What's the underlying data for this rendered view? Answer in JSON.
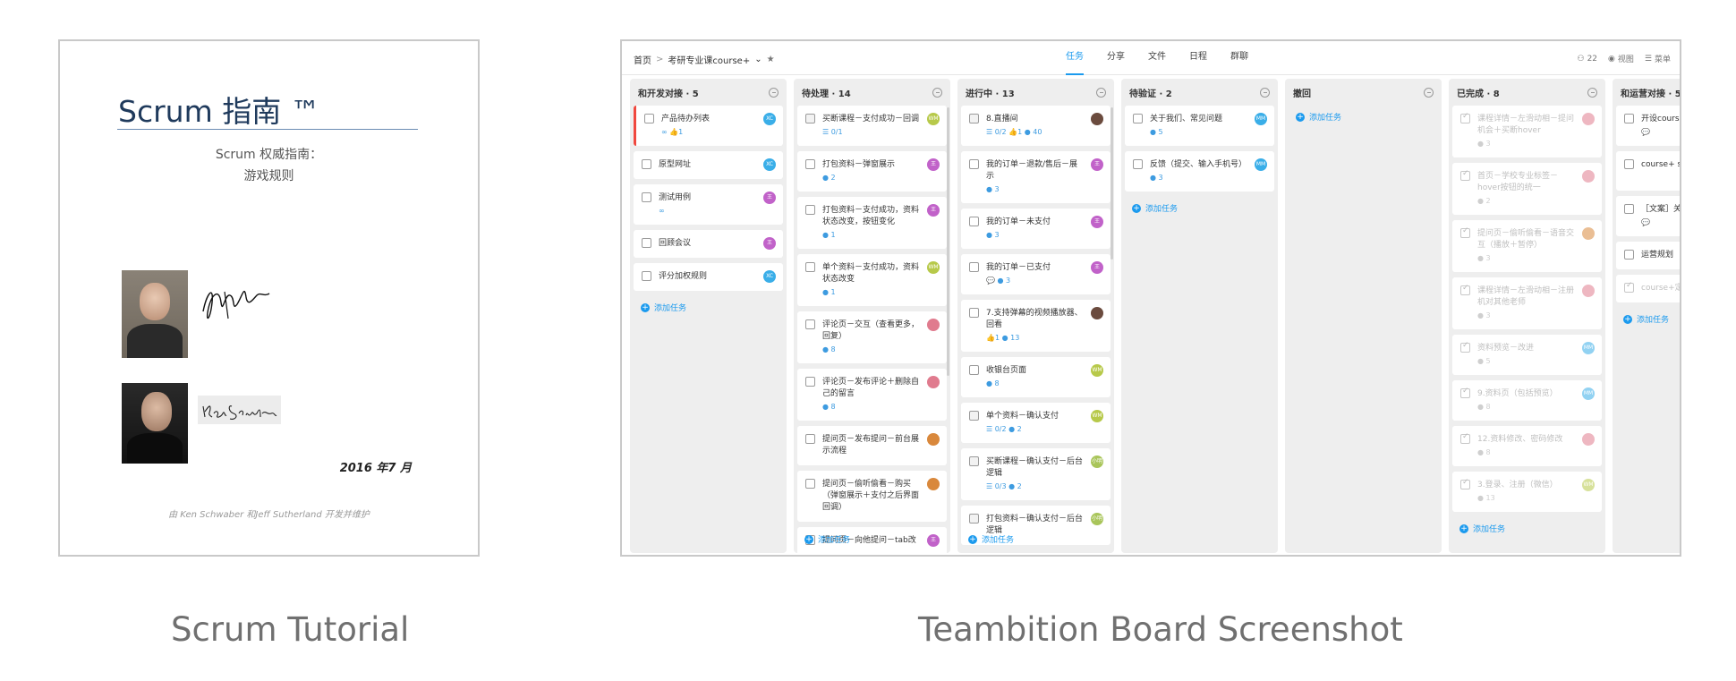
{
  "doc": {
    "title": "Scrum 指南 ™",
    "subtitle1": "Scrum 权威指南：",
    "subtitle2": "游戏规则",
    "date": "2016 年7 月",
    "footer": "由 Ken Schwaber 和Jeff Sutherland 开发并维护",
    "signature1": "Jeff Sutherland",
    "signature2": "Ken Schwaber"
  },
  "captions": {
    "left": "Scrum Tutorial",
    "right": "Teambition Board Screenshot"
  },
  "board": {
    "breadcrumb": {
      "home": "首页",
      "sep": ">",
      "project": "考研专业课course+"
    },
    "tabs": [
      "任务",
      "分享",
      "文件",
      "日程",
      "群聊"
    ],
    "tools": {
      "members": "22",
      "view": "视图",
      "menu": "菜单"
    },
    "add_task": "添加任务",
    "colors": {
      "accent": "#1b9aee",
      "highlight": "#f0483e"
    },
    "columns": [
      {
        "title": "和开发对接 · 5",
        "cards": [
          {
            "title": "产品待办列表",
            "meta": "∞  👍1",
            "avatar": "XC",
            "avcolor": "#3aaee8",
            "hl": true
          },
          {
            "title": "原型网址",
            "meta": "",
            "avatar": "XC",
            "avcolor": "#3aaee8"
          },
          {
            "title": "测试用例",
            "meta": "∞",
            "avatar": "王",
            "avcolor": "#c162c9"
          },
          {
            "title": "回顾会议",
            "meta": "",
            "avatar": "王",
            "avcolor": "#c162c9"
          },
          {
            "title": "评分加权规则",
            "meta": "",
            "avatar": "XC",
            "avcolor": "#3aaee8"
          }
        ]
      },
      {
        "title": "待处理 · 14",
        "cards": [
          {
            "title": "买断课程－支付成功－回调",
            "meta": "☰ 0/1",
            "avatar": "WM",
            "avcolor": "#b7c94a",
            "gray": true
          },
          {
            "title": "打包资料－弹窗展示",
            "meta": "● 2",
            "avatar": "王",
            "avcolor": "#c162c9"
          },
          {
            "title": "打包资料－支付成功，资料状态改变，按钮变化",
            "meta": "● 1",
            "avatar": "王",
            "avcolor": "#c162c9"
          },
          {
            "title": "单个资料－支付成功，资料状态改变",
            "meta": "● 1",
            "avatar": "WM",
            "avcolor": "#b7c94a"
          },
          {
            "title": "评论页－交互（查看更多，回复）",
            "meta": "● 8",
            "avatar": "",
            "avcolor": "#e07b8e"
          },
          {
            "title": "评论页－发布评论＋删除自己的留言",
            "meta": "● 8",
            "avatar": "",
            "avcolor": "#e07b8e"
          },
          {
            "title": "提问页－发布提问－前台展示流程",
            "meta": "",
            "avatar": "",
            "avcolor": "#d9883c"
          },
          {
            "title": "提问页－偷听偷看－购买（弹窗展示＋支付之后界面回调）",
            "meta": "",
            "avatar": "",
            "avcolor": "#d9883c"
          },
          {
            "title": "提问页－向他提问－tab改",
            "meta": "",
            "avatar": "王",
            "avcolor": "#c162c9"
          }
        ]
      },
      {
        "title": "进行中 · 13",
        "cards": [
          {
            "title": "8.直播间",
            "meta": "☰ 0/2  👍1  ● 40",
            "avatar": "",
            "avcolor": "#6b4b3e",
            "gray": true
          },
          {
            "title": "我的订单－退款/售后－展示",
            "meta": "● 3",
            "avatar": "王",
            "avcolor": "#c162c9"
          },
          {
            "title": "我的订单－未支付",
            "meta": "● 3",
            "avatar": "王",
            "avcolor": "#c162c9"
          },
          {
            "title": "我的订单－已支付",
            "meta": "💬  ● 3",
            "avatar": "王",
            "avcolor": "#c162c9"
          },
          {
            "title": "7.支持弹幕的视频播放器、回看",
            "meta": "👍1  ● 13",
            "avatar": "",
            "avcolor": "#6b4b3e"
          },
          {
            "title": "收银台页面",
            "meta": "● 8",
            "avatar": "WM",
            "avcolor": "#b7c94a"
          },
          {
            "title": "单个资料－确认支付",
            "meta": "☰ 0/2  ● 2",
            "avatar": "WM",
            "avcolor": "#b7c94a",
            "gray": true
          },
          {
            "title": "买断课程－确认支付－后台逻辑",
            "meta": "☰ 0/3  ● 2",
            "avatar": "小明",
            "avcolor": "#a9c55a",
            "gray": true
          },
          {
            "title": "打包资料－确认支付－后台逻辑",
            "meta": "",
            "avatar": "小明",
            "avcolor": "#a9c55a",
            "gray": true
          }
        ]
      },
      {
        "title": "待验证 · 2",
        "cards": [
          {
            "title": "关于我们、常见问题",
            "meta": "● 5",
            "avatar": "MM",
            "avcolor": "#3aaee8"
          },
          {
            "title": "反馈（提交、输入手机号）",
            "meta": "● 3",
            "avatar": "MM",
            "avcolor": "#3aaee8"
          }
        ]
      },
      {
        "title": "撤回",
        "cards": []
      },
      {
        "title": "已完成 · 8",
        "cards": [
          {
            "title": "课程详情－左滑动相－提问机会＋买断hover",
            "meta": "● 3",
            "avatar": "",
            "avcolor": "#e07b8e",
            "done": true
          },
          {
            "title": "首页－学校专业标签－hover按钮的统一",
            "meta": "● 2",
            "avatar": "",
            "avcolor": "#e07b8e",
            "done": true
          },
          {
            "title": "提问页－偷听偷看－语音交互（播放＋暂停）",
            "meta": "● 3",
            "avatar": "",
            "avcolor": "#d9883c",
            "done": true
          },
          {
            "title": "课程详情－左滑动相－注册机对其他老师",
            "meta": "● 3",
            "avatar": "",
            "avcolor": "#e07b8e",
            "done": true
          },
          {
            "title": "资料预览－改进",
            "meta": "● 5",
            "avatar": "MM",
            "avcolor": "#3aaee8",
            "done": true
          },
          {
            "title": "9.资料页（包括预览）",
            "meta": "● 8",
            "avatar": "MM",
            "avcolor": "#3aaee8",
            "done": true
          },
          {
            "title": "12.资料修改、密码修改",
            "meta": "● 8",
            "avatar": "",
            "avcolor": "#e07b8e",
            "done": true
          },
          {
            "title": "3.登录、注册（微信）",
            "meta": "● 13",
            "avatar": "WM",
            "avcolor": "#b7c94a",
            "done": true
          }
        ]
      },
      {
        "title": "和运营对接 · 5",
        "cards": [
          {
            "title": "开设course",
            "meta": "💬",
            "avatar": "",
            "avcolor": "#3aaee8"
          },
          {
            "title": "course+ slo更专业",
            "meta": "",
            "avatar": "",
            "avcolor": "#3aaee8"
          },
          {
            "title": "［文案］关",
            "meta": "💬",
            "avatar": "",
            "avcolor": "#3aaee8"
          },
          {
            "title": "运营规划",
            "meta": "",
            "avatar": "",
            "avcolor": "#3aaee8"
          },
          {
            "title": "course+定",
            "meta": "",
            "avatar": "",
            "avcolor": "#3aaee8",
            "done": true
          }
        ]
      }
    ]
  }
}
